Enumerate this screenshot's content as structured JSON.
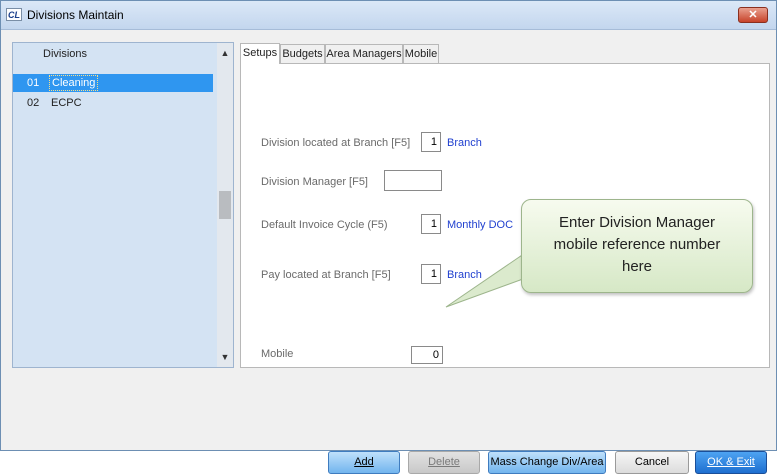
{
  "window": {
    "title": "Divisions Maintain",
    "app_icon_text": "CL",
    "close_symbol": "✕"
  },
  "divisions_list": {
    "header": "Divisions",
    "items": [
      {
        "num": "01",
        "label": "Cleaning",
        "selected": true
      },
      {
        "num": "02",
        "label": "ECPC",
        "selected": false
      }
    ]
  },
  "tabs": [
    {
      "label": "Setups",
      "active": true
    },
    {
      "label": "Budgets",
      "active": false
    },
    {
      "label": "Area Managers",
      "active": false
    },
    {
      "label": "Mobile",
      "active": false
    }
  ],
  "setups": {
    "division_branch": {
      "label": "Division located at Branch [F5]",
      "value": "1",
      "link": "Branch"
    },
    "division_manager": {
      "label": "Division Manager [F5]",
      "value": ""
    },
    "invoice_cycle": {
      "label": "Default Invoice Cycle (F5)",
      "value": "1",
      "link": "Monthly DOC"
    },
    "pay_branch": {
      "label": "Pay located at Branch [F5]",
      "value": "1",
      "link": "Branch"
    },
    "mobile": {
      "label": "Mobile",
      "value": "0"
    }
  },
  "callout": {
    "line1": "Enter Division Manager",
    "line2": "mobile reference number",
    "line3": "here"
  },
  "buttons": {
    "add": "Add",
    "delete": "Delete",
    "mass_change": "Mass Change Div/Area",
    "cancel": "Cancel",
    "ok_exit": "OK & Exit"
  },
  "colors": {
    "selection": "#2f96f0",
    "link": "#1f3fcf",
    "callout": "#e6f0da"
  }
}
